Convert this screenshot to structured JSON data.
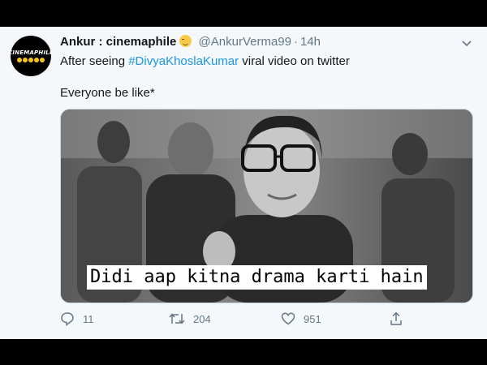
{
  "tweet": {
    "avatar_text": "CINEMAPHILE",
    "display_name": "Ankur : cinemaphile",
    "handle": "@AnkurVerma99",
    "separator": "·",
    "time": "14h",
    "text_prefix": "After seeing ",
    "hashtag": "#DivyaKhoslaKumar",
    "text_suffix": " viral video on twitter",
    "text_line2": "Everyone be like*",
    "media_caption": "Didi aap kitna drama karti hain"
  },
  "actions": {
    "replies": "11",
    "retweets": "204",
    "likes": "951"
  },
  "colors": {
    "link": "#1b95e0",
    "muted": "#657786",
    "background": "#f5f8fa"
  },
  "icons": [
    "chevron-down-icon",
    "reply-icon",
    "retweet-icon",
    "like-icon",
    "share-icon"
  ]
}
